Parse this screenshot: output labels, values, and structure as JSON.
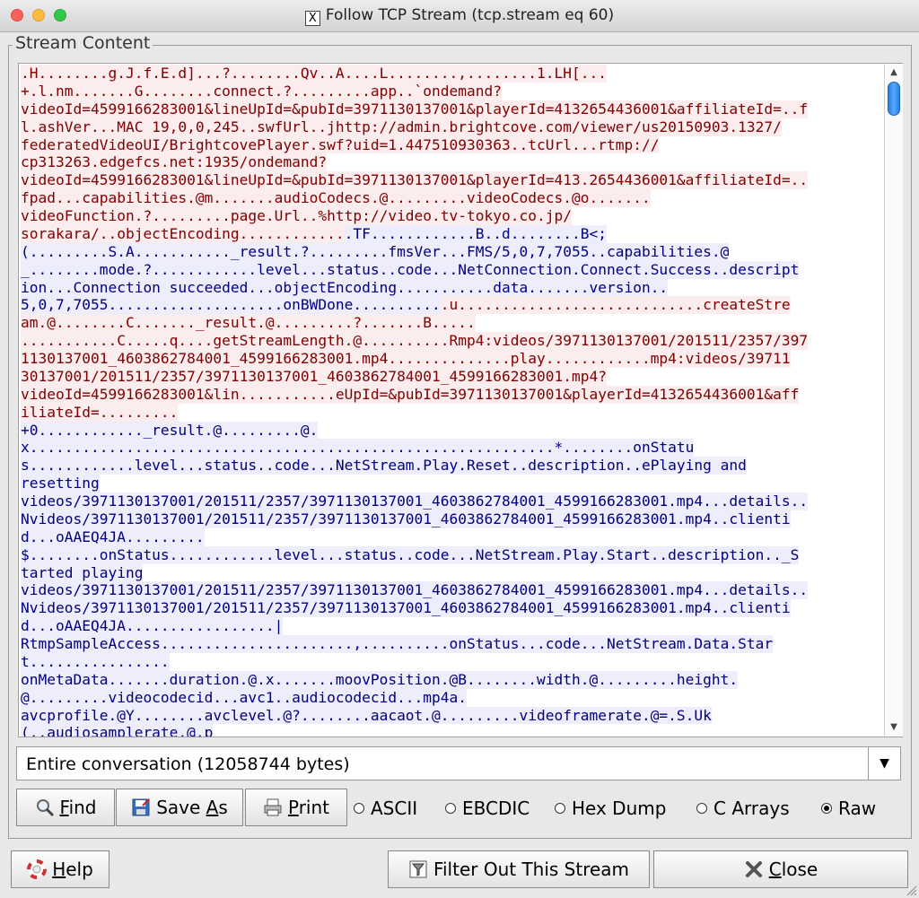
{
  "window": {
    "title": "Follow TCP Stream (tcp.stream eq 60)"
  },
  "stream": {
    "legend": "Stream Content",
    "lines": [
      [
        {
          "t": ".H........g.J.f.E.d]...?........Qv..A....L........,........1.LH[...",
          "d": "c"
        }
      ],
      [
        {
          "t": "+.l.nm.......G........connect.?.........app..`ondemand?",
          "d": "c"
        }
      ],
      [
        {
          "t": "videoId=4599166283001&lineUpId=&pubId=3971130137001&playerId=4132654436001&affiliateId=..f",
          "d": "c"
        }
      ],
      [
        {
          "t": "l.ashVer...MAC 19,0,0,245..swfUrl..jhttp://admin.brightcove.com/viewer/us20150903.1327/",
          "d": "c"
        }
      ],
      [
        {
          "t": "federatedVideoUI/BrightcovePlayer.swf?uid=1.447510930363..tcUrl...rtmp://",
          "d": "c"
        }
      ],
      [
        {
          "t": "cp313263.edgefcs.net:1935/ondemand?",
          "d": "c"
        }
      ],
      [
        {
          "t": "videoId=4599166283001&lineUpId=&pubId=3971130137001&playerId=413.2654436001&affiliateId=..",
          "d": "c"
        }
      ],
      [
        {
          "t": "fpad...capabilities.@m.......audioCodecs.@.........videoCodecs.@o.......",
          "d": "c"
        }
      ],
      [
        {
          "t": "videoFunction.?.........page.Url..%http://video.tv-tokyo.co.jp/",
          "d": "c"
        }
      ],
      [
        {
          "t": "sorakara/..objectEncoding............",
          "d": "c"
        },
        {
          "t": ".TF............B..d........B<;",
          "d": "s"
        }
      ],
      [
        {
          "t": "(.........S.A..........._result.?.........fmsVer...FMS/5,0,7,7055..capabilities.@",
          "d": "s"
        }
      ],
      [
        {
          "t": "_........mode.?............level...status..code...NetConnection.Connect.Success..descript",
          "d": "s"
        }
      ],
      [
        {
          "t": "ion...Connection succeeded...objectEncoding...........data.......version..",
          "d": "s"
        }
      ],
      [
        {
          "t": "5,0,7,7055....................onBWDone..........",
          "d": "s"
        },
        {
          "t": ".u............................createStre",
          "d": "c"
        }
      ],
      [
        {
          "t": "am.@........C......._result.@.........?.......B.....",
          "d": "c"
        }
      ],
      [
        {
          "t": "...........C.....q....getStreamLength.@..........Rmp4:videos/3971130137001/201511/2357/397",
          "d": "c"
        }
      ],
      [
        {
          "t": "1130137001_4603862784001_4599166283001.mp4..............play............mp4:videos/39711",
          "d": "c"
        }
      ],
      [
        {
          "t": "30137001/201511/2357/3971130137001_4603862784001_4599166283001.mp4?",
          "d": "c"
        }
      ],
      [
        {
          "t": "videoId=4599166283001&lin...........eUpId=&pubId=3971130137001&playerId=4132654436001&aff",
          "d": "c"
        }
      ],
      [
        {
          "t": "iliateId=.........",
          "d": "c"
        }
      ],
      [
        {
          "t": "+0............_result.@.........@.",
          "d": "s"
        }
      ],
      [
        {
          "t": "x............................................................*........onStatu",
          "d": "s"
        }
      ],
      [
        {
          "t": "s............level...status..code...NetStream.Play.Reset..description..ePlaying and",
          "d": "s"
        }
      ],
      [
        {
          "t": "resetting",
          "d": "s"
        }
      ],
      [
        {
          "t": "videos/3971130137001/201511/2357/3971130137001_4603862784001_4599166283001.mp4...details..",
          "d": "s"
        }
      ],
      [
        {
          "t": "Nvideos/3971130137001/201511/2357/3971130137001_4603862784001_4599166283001.mp4..clienti",
          "d": "s"
        }
      ],
      [
        {
          "t": "d...oAAEQ4JA.........",
          "d": "s"
        }
      ],
      [
        {
          "t": "$........onStatus............level...status..code...NetStream.Play.Start..description.._S",
          "d": "s"
        }
      ],
      [
        {
          "t": "tarted playing",
          "d": "s"
        }
      ],
      [
        {
          "t": "videos/3971130137001/201511/2357/3971130137001_4603862784001_4599166283001.mp4...details..",
          "d": "s"
        }
      ],
      [
        {
          "t": "Nvideos/3971130137001/201511/2357/3971130137001_4603862784001_4599166283001.mp4..clienti",
          "d": "s"
        }
      ],
      [
        {
          "t": "d...oAAEQ4JA.................|",
          "d": "s"
        }
      ],
      [
        {
          "t": "RtmpSampleAccess......................,..........onStatus...code...NetStream.Data.Star",
          "d": "s"
        }
      ],
      [
        {
          "t": "t................",
          "d": "s"
        }
      ],
      [
        {
          "t": "onMetaData.......duration.@.x.......moovPosition.@B........width.@.........height.",
          "d": "s"
        }
      ],
      [
        {
          "t": "@.........videocodecid...avc1..audiocodecid...mp4a.",
          "d": "s"
        }
      ],
      [
        {
          "t": "avcprofile.@Y........avclevel.@?........aacaot.@.........videoframerate.@=.S.Uk",
          "d": "s"
        }
      ],
      [
        {
          "t": "(..audiosamplerate.@.p",
          "d": "s"
        }
      ]
    ]
  },
  "scroll": {
    "position": 0.0
  },
  "conversation": {
    "selected": "Entire conversation (12058744 bytes)"
  },
  "buttons": {
    "find": {
      "pre": "",
      "key": "F",
      "post": "ind"
    },
    "save_as": {
      "pre": "Save ",
      "key": "A",
      "post": "s"
    },
    "print": {
      "pre": "",
      "key": "P",
      "post": "rint"
    },
    "help": {
      "pre": "",
      "key": "H",
      "post": "elp"
    },
    "filter": {
      "label": "Filter Out This Stream"
    },
    "close": {
      "pre": "",
      "key": "C",
      "post": "lose"
    }
  },
  "format": {
    "options": [
      "ASCII",
      "EBCDIC",
      "Hex Dump",
      "C Arrays",
      "Raw"
    ],
    "selected": "Raw"
  },
  "colors": {
    "client_fg": "#7f0000",
    "client_bg": "#fbeded",
    "server_fg": "#00007f",
    "server_bg": "#ededfb"
  },
  "icons": [
    "x11-icon",
    "magnifier-icon",
    "save-disk-icon",
    "printer-icon",
    "lifebuoy-icon",
    "filter-icon",
    "close-x-icon"
  ]
}
